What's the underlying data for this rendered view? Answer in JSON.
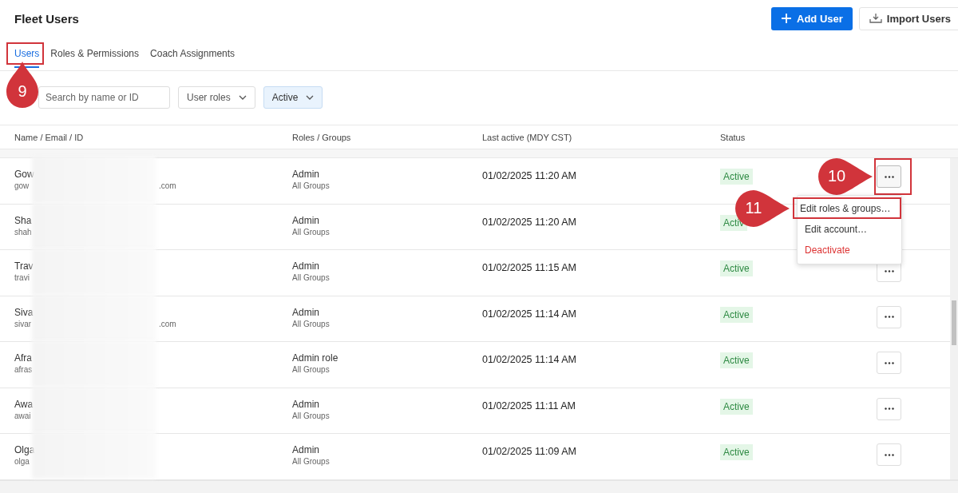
{
  "page": {
    "title": "Fleet Users"
  },
  "actions": [
    {
      "kind": "primary",
      "label": "Add User"
    },
    {
      "kind": "secondary",
      "label": "Import Users"
    }
  ],
  "tabs": [
    {
      "label": "Users",
      "selected": true,
      "callout": "9"
    },
    {
      "label": "Roles & Permissions",
      "selected": false
    },
    {
      "label": "Coach Assignments",
      "selected": false
    }
  ],
  "search": {
    "placeholder": "Search by name or ID"
  },
  "filters": [
    {
      "label": "User roles",
      "selected": false
    },
    {
      "label": "Active",
      "selected": true
    }
  ],
  "table": {
    "columns": [
      "Name / Email / ID",
      "Roles / Groups",
      "Last active (MDY CST)",
      "Status"
    ],
    "rows": [
      {
        "name": "Gow",
        "email": "gow",
        "email_end": ".com",
        "role": "Admin",
        "groups": "All Groups",
        "last_active": "01/02/2025 11:20 AM",
        "status": "Active",
        "callout": "10",
        "menu_open": true
      },
      {
        "name": "Sha",
        "email": "shah",
        "role": "Admin",
        "groups": "All Groups",
        "last_active": "01/02/2025 11:20 AM",
        "status": "Activ",
        "menu_open": false
      },
      {
        "name": "Trav",
        "email": "travi",
        "role": "Admin",
        "groups": "All Groups",
        "last_active": "01/02/2025 11:15 AM",
        "status": "Active",
        "menu_open": false
      },
      {
        "name": "Siva",
        "email": "sivar",
        "email_end": ".com",
        "role": "Admin",
        "groups": "All Groups",
        "last_active": "01/02/2025 11:14 AM",
        "status": "Active",
        "menu_open": false
      },
      {
        "name": "Afra",
        "email": "afras",
        "role": "Admin role",
        "groups": "All Groups",
        "last_active": "01/02/2025 11:14 AM",
        "status": "Active",
        "menu_open": false
      },
      {
        "name": "Awa",
        "email": "awai",
        "role": "Admin",
        "groups": "All Groups",
        "last_active": "01/02/2025 11:11 AM",
        "status": "Active",
        "menu_open": false
      },
      {
        "name": "Olga",
        "email": "olga",
        "role": "Admin",
        "groups": "All Groups",
        "last_active": "01/02/2025 11:09 AM",
        "status": "Active",
        "menu_open": false
      }
    ]
  },
  "row_menu": {
    "items": [
      {
        "label": "Edit roles & groups…",
        "kind": "normal",
        "callout": "11"
      },
      {
        "label": "Edit account…",
        "kind": "normal"
      },
      {
        "label": "Deactivate",
        "kind": "danger"
      }
    ]
  }
}
